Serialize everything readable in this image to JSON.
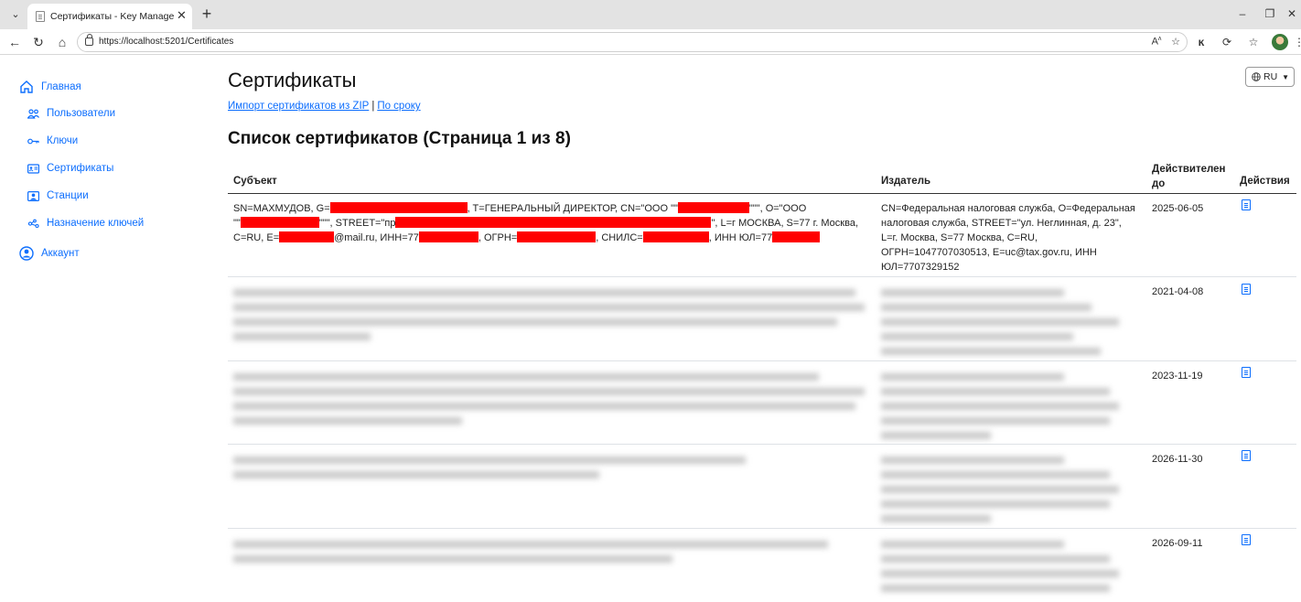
{
  "browser": {
    "tab_title": "Сертификаты - Key Manager Адм",
    "tab_close": "✕",
    "new_tab": "+",
    "tab_list": "⌄",
    "url": "https://localhost:5201/Certificates",
    "back": "←",
    "forward": "›",
    "reload": "↻",
    "home": "⌂",
    "read_aloud": "Aᴬ",
    "favorite": "☆",
    "minimize": "–",
    "restore": "❐",
    "close": "✕",
    "more": "⋮",
    "icons": [
      "lock-icon",
      "read-aloud-icon",
      "favorite-star-icon",
      "extension-k-icon",
      "browser-essentials-icon",
      "favorites-icon",
      "profile-avatar-icon",
      "more-icon"
    ]
  },
  "sidebar": {
    "items": [
      {
        "label": "Главная",
        "icon": "home-icon"
      },
      {
        "label": "Пользователи",
        "icon": "users-icon"
      },
      {
        "label": "Ключи",
        "icon": "key-icon"
      },
      {
        "label": "Сертификаты",
        "icon": "certificate-card-icon"
      },
      {
        "label": "Станции",
        "icon": "station-icon"
      },
      {
        "label": "Назначение ключей",
        "icon": "key-assign-icon"
      },
      {
        "label": "Аккаунт",
        "icon": "account-icon"
      }
    ],
    "accent_color": "#0d6efd"
  },
  "lang": {
    "label": "RU",
    "caret": "▼",
    "icon": "globe-icon"
  },
  "page": {
    "title": "Сертификаты",
    "link_import": "Импорт сертификатов из ZIP",
    "link_sep": "|",
    "link_by_term": "По сроку",
    "list_title": "Список сертификатов (Страница 1 из 8)"
  },
  "table": {
    "headers": {
      "subject": "Субъект",
      "issuer": "Издатель",
      "valid_to_line1": "Действителен",
      "valid_to_line2": "до",
      "actions": "Действия"
    },
    "row1": {
      "subject": {
        "p1": "SN=МАХМУДОВ, G=",
        "p2": ", T=ГЕНЕРАЛЬНЫЙ ДИРЕКТОР, CN=\"ООО \"\"",
        "p3": "\"\"\", O=\"ООО",
        "p4": "\"\"",
        "p5": "\"\"\", STREET=\"пр",
        "p6": "\", L=г МОСКВА, S=77 г. Москва,",
        "p7": "C=RU, E=",
        "p8": "@mail.ru, ИНН=77",
        "p9": ", ОГРН=",
        "p10": ", СНИЛС=",
        "p11": ", ИНН ЮЛ=77"
      },
      "issuer": "CN=Федеральная налоговая служба, O=Федеральная налоговая служба, STREET=\"ул. Неглинная, д. 23\", L=г. Москва, S=77 Москва, C=RU, ОГРН=1047707030513, E=uc@tax.gov.ru, ИНН ЮЛ=7707329152",
      "valid_to": "2025-06-05",
      "action_icon": "document-icon"
    },
    "rows": [
      {
        "valid_to": "2021-04-08",
        "action_icon": "document-icon"
      },
      {
        "valid_to": "2023-11-19",
        "action_icon": "document-icon"
      },
      {
        "valid_to": "2026-11-30",
        "action_icon": "document-icon"
      },
      {
        "valid_to": "2026-09-11",
        "action_icon": "document-icon"
      }
    ],
    "redaction_color": "#ff0000"
  }
}
